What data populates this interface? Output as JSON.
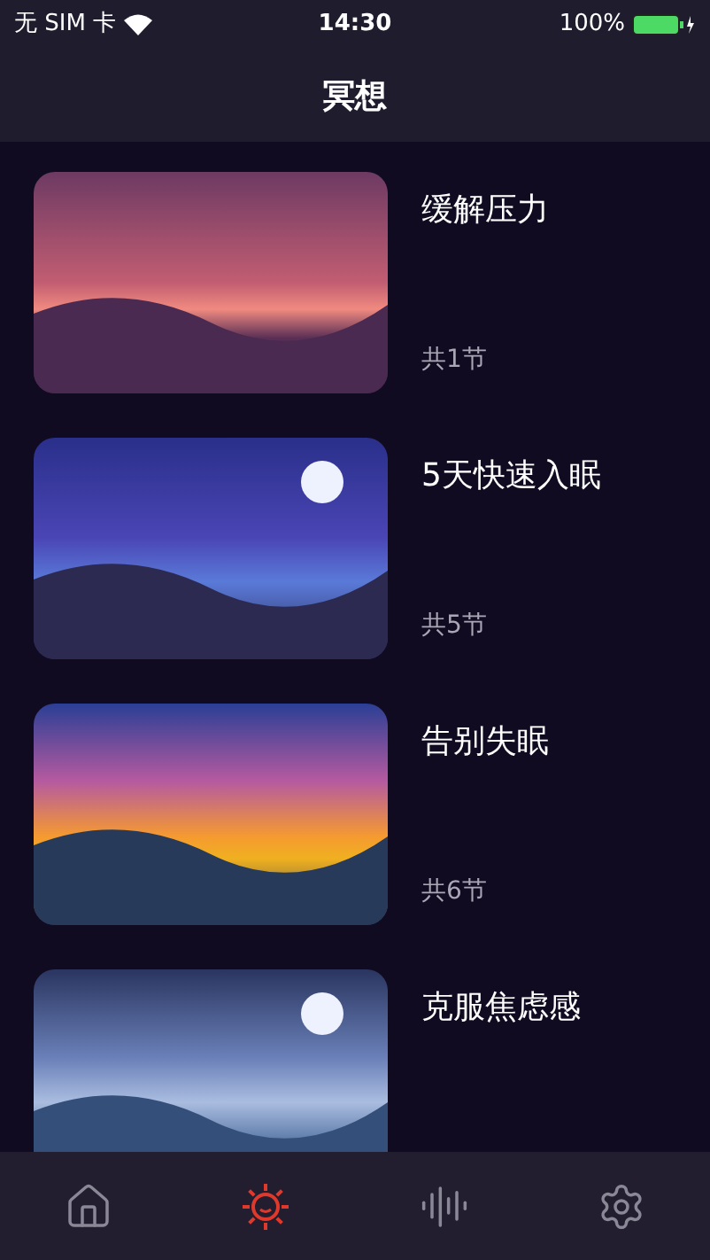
{
  "status_bar": {
    "carrier": "无 SIM 卡",
    "time": "14:30",
    "battery": "100%"
  },
  "title": "冥想",
  "courses": [
    {
      "title": "缓解压力",
      "count": "共1节",
      "kind": "sunset"
    },
    {
      "title": "5天快速入眠",
      "count": "共5节",
      "kind": "night"
    },
    {
      "title": "告别失眠",
      "count": "共6节",
      "kind": "dawn"
    },
    {
      "title": "克服焦虑感",
      "kind": "lake"
    }
  ],
  "tabs": [
    {
      "kind": "home",
      "selected": false
    },
    {
      "kind": "sun",
      "selected": true
    },
    {
      "kind": "sound",
      "selected": false
    },
    {
      "kind": "settings",
      "selected": false
    }
  ]
}
